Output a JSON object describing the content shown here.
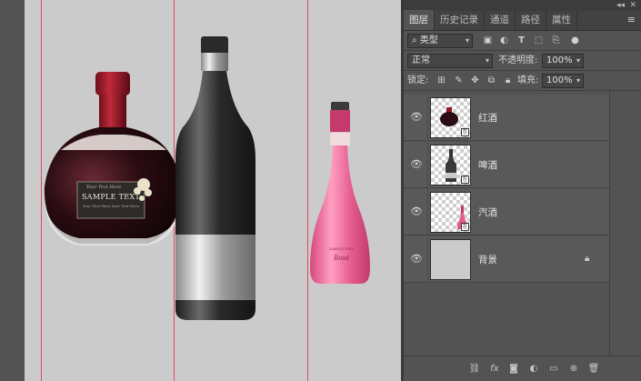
{
  "panel": {
    "tabs": [
      "图层",
      "历史记录",
      "通道",
      "路径",
      "属性"
    ],
    "active_tab": 0,
    "filter": {
      "label": "类型"
    },
    "blend_mode": "正常",
    "opacity_label": "不透明度:",
    "opacity_value": "100%",
    "lock_label": "锁定:",
    "fill_label": "填充:",
    "fill_value": "100%",
    "layers": [
      {
        "name": "红酒",
        "locked": false,
        "smart": true
      },
      {
        "name": "啤酒",
        "locked": false,
        "smart": true
      },
      {
        "name": "汽酒",
        "locked": false,
        "smart": true
      },
      {
        "name": "背景",
        "locked": true,
        "smart": false
      }
    ]
  },
  "canvas": {
    "wine_label": {
      "script": "Your Text Here",
      "main": "SAMPLE TEXT",
      "small": "Your Text Here Your Text Here"
    },
    "rose_label": {
      "top": "SAMPLE TEXT",
      "script": "Rosé"
    }
  },
  "colors": {
    "guide": "#e0485c",
    "canvas_bg": "#cbcbcb",
    "panel_bg": "#535353",
    "rose": "#e35a8c"
  }
}
